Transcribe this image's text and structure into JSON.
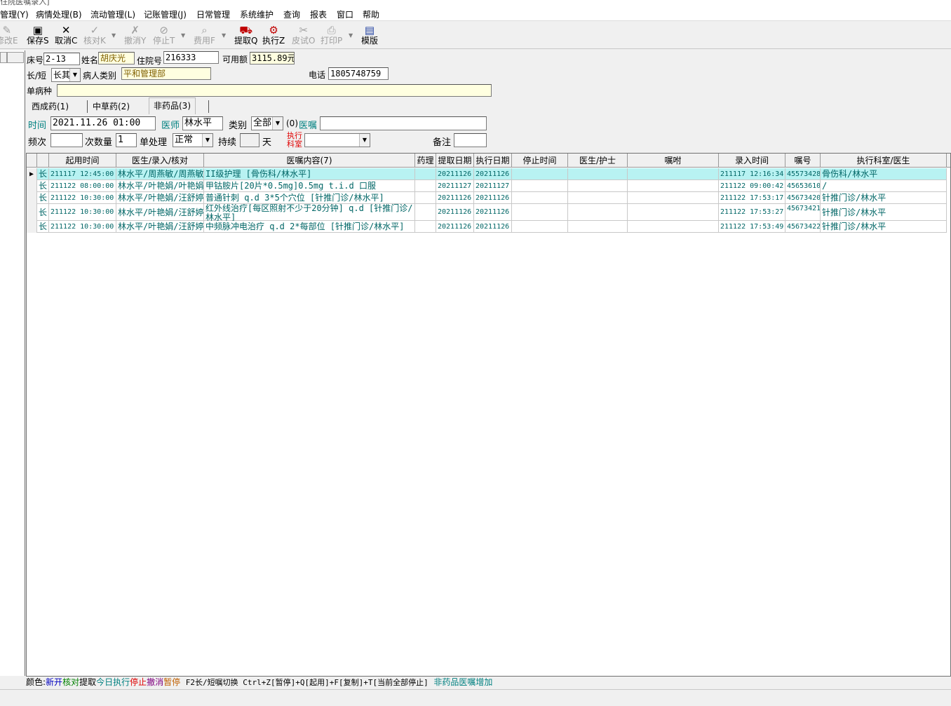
{
  "window": {
    "title": "[住院医嘱录入]"
  },
  "menu": [
    "管理(Y)",
    "病情处理(B)",
    "流动管理(L)",
    "记账管理(J)",
    "日常管理",
    "系统维护",
    "查询",
    "报表",
    "窗口",
    "帮助"
  ],
  "toolbar": {
    "modify": "修改E",
    "save": "保存S",
    "cancel": "取消C",
    "verify": "核对K",
    "revoke": "撤消Y",
    "stop": "停止T",
    "fee": "费用F",
    "fetch": "提取Q",
    "execute": "执行Z",
    "skintest": "皮试O",
    "print": "打印P",
    "template": "模版"
  },
  "patient": {
    "bed_label": "床号",
    "bed": "2-13",
    "name_label": "姓名",
    "name": "胡庆光",
    "admission_label": "住院号",
    "admission": "216333",
    "balance_label": "可用额",
    "balance": "3115.89元",
    "term_label": "长/短",
    "term": "长其",
    "category_label": "病人类别",
    "category": "平和管理部",
    "phone_label": "电话",
    "phone": "1805748759",
    "disease_label": "单病种",
    "disease": ""
  },
  "tabs": [
    "西成药(1)",
    "中草药(2)",
    "非药品(3)"
  ],
  "form": {
    "time_label": "时间",
    "time": "2021.11.26 01:00",
    "doctor_label": "医师",
    "doctor": "林水平",
    "type_label": "类别",
    "type": "全部",
    "order_prefix": "(0)",
    "order_label": "医嘱",
    "order": "",
    "freq_label": "频次",
    "freq": "",
    "qty_label": "次数量",
    "qty": "1",
    "handling_label": "单处理",
    "handling": "正常",
    "duration_label": "持续",
    "duration": "",
    "days_label": "天",
    "dept_label_1": "执行",
    "dept_label_2": "科室",
    "dept": "",
    "note_label": "备注",
    "note": ""
  },
  "grid": {
    "columns": [
      "",
      "",
      "起用时间",
      "医生/录入/核对",
      "医嘱内容(7)",
      "药理",
      "提取日期",
      "执行日期",
      "停止时间",
      "医生/护士",
      "嘱咐",
      "录入时间",
      "嘱号",
      "执行科室/医生"
    ],
    "rows": [
      {
        "marker": "▶",
        "term": "长",
        "start": "211117 12:45:00",
        "staff": "林水平/周燕敏/周燕敏",
        "content": "II级护理  [骨伤科/林水平]",
        "pharm": "",
        "fetch": "20211126",
        "exec": "20211126",
        "stop": "",
        "nurse": "",
        "remark": "",
        "entered": "211117 12:16:34",
        "no": "45573428",
        "dept": "骨伤科/林水平"
      },
      {
        "marker": "",
        "term": "长",
        "start": "211122 08:00:00",
        "staff": "林水平/叶艳娟/叶艳娟",
        "content": "甲钴胺片[20片*0.5mg]0.5mg t.i.d 口服",
        "pharm": "",
        "fetch": "20211127",
        "exec": "20211127",
        "stop": "",
        "nurse": "",
        "remark": "",
        "entered": "211122 09:00:42",
        "no": "45653610",
        "dept": "/"
      },
      {
        "marker": "",
        "term": "长",
        "start": "211122 10:30:00",
        "staff": "林水平/叶艳娟/汪舒婷",
        "content": "普通针刺 q.d 3*5个穴位  [针推门诊/林水平]",
        "pharm": "",
        "fetch": "20211126",
        "exec": "20211126",
        "stop": "",
        "nurse": "",
        "remark": "",
        "entered": "211122 17:53:17",
        "no": "45673420",
        "dept": "针推门诊/林水平"
      },
      {
        "marker": "",
        "term": "长",
        "start": "211122 10:30:00",
        "staff": "林水平/叶艳娟/汪舒婷",
        "content": "红外线治疗[每区照射不少于20分钟] q.d  [针推门诊/林水平]",
        "pharm": "",
        "fetch": "20211126",
        "exec": "20211126",
        "stop": "",
        "nurse": "",
        "remark": "",
        "entered": "211122 17:53:27",
        "no": "45673421",
        "dept": "针推门诊/林水平"
      },
      {
        "marker": "",
        "term": "长",
        "start": "211122 10:30:00",
        "staff": "林水平/叶艳娟/汪舒婷",
        "content": "中频脉冲电治疗 q.d 2*每部位  [针推门诊/林水平]",
        "pharm": "",
        "fetch": "20211126",
        "exec": "20211126",
        "stop": "",
        "nurse": "",
        "remark": "",
        "entered": "211122 17:53:49",
        "no": "45673422",
        "dept": "针推门诊/林水平"
      }
    ]
  },
  "legend": {
    "prefix": "颜色:",
    "new": "新开",
    "verified": "核对",
    "fetched": "提取",
    "today": "今日执行",
    "stopped": "停止",
    "revoked": "撤消",
    "paused": "暂停",
    "shortcuts": "F2长/短嘱切换  Ctrl+Z[暂停]+Q[起用]+F[复制]+T[当前全部停止]",
    "nondrug": "非药品医嘱增加"
  },
  "colors": {
    "new": "#0000c0",
    "verified": "#008000",
    "fetched": "#000000",
    "today": "#008080",
    "stopped": "#e00000",
    "revoked": "#800080",
    "paused": "#c06000",
    "selected_row": "#b8f2f2"
  }
}
